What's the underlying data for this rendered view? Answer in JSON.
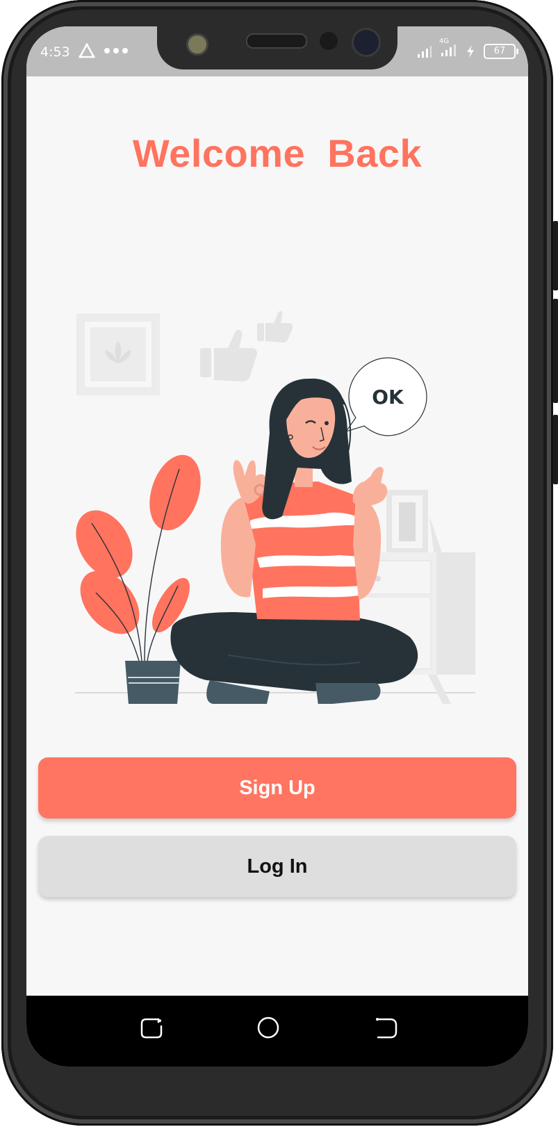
{
  "status_bar": {
    "time": "4:53",
    "network": "4G",
    "battery": "67",
    "icons": [
      "alert-triangle-icon",
      "more-dots-icon",
      "signal-icon",
      "signal-4g-icon",
      "charging-icon",
      "battery-icon"
    ]
  },
  "main": {
    "title": "Welcome  Back",
    "illustration": {
      "speech_bubble": "OK"
    }
  },
  "actions": {
    "signup_label": "Sign Up",
    "login_label": "Log In"
  },
  "nav": {
    "icons": [
      "recent-apps-icon",
      "home-icon",
      "back-icon"
    ]
  },
  "colors": {
    "accent": "#ff735f",
    "button_secondary": "#dedede",
    "background": "#f7f7f7",
    "dark": "#263238"
  }
}
